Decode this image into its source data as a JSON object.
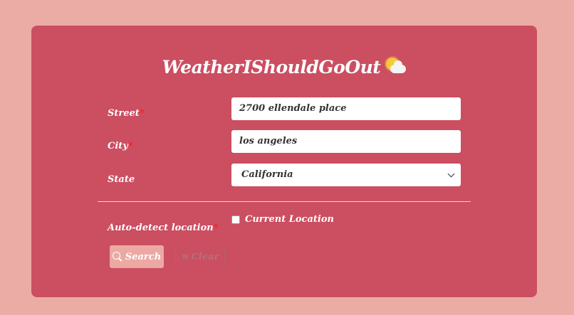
{
  "app": {
    "title": "WeatherIShouldGoOut"
  },
  "form": {
    "street": {
      "label": "Street",
      "value": "2700 ellendale place"
    },
    "city": {
      "label": "City",
      "value": "los angeles"
    },
    "state": {
      "label": "State",
      "value": "California"
    },
    "auto_detect": {
      "label": "Auto-detect location",
      "checkbox_label": "Current Location"
    },
    "required_mark": "*"
  },
  "buttons": {
    "search": "Search",
    "clear": "Clear"
  },
  "icons": {
    "title_icon": "sun-behind-cloud-icon",
    "search_icon": "search-icon",
    "clear_icon": "clear-icon",
    "dropdown_icon": "chevron-down-icon"
  },
  "colors": {
    "page_bg": "#ecaca6",
    "card_bg": "#cb4e61",
    "required": "#ff2020",
    "search_button": "#eca9a3"
  }
}
